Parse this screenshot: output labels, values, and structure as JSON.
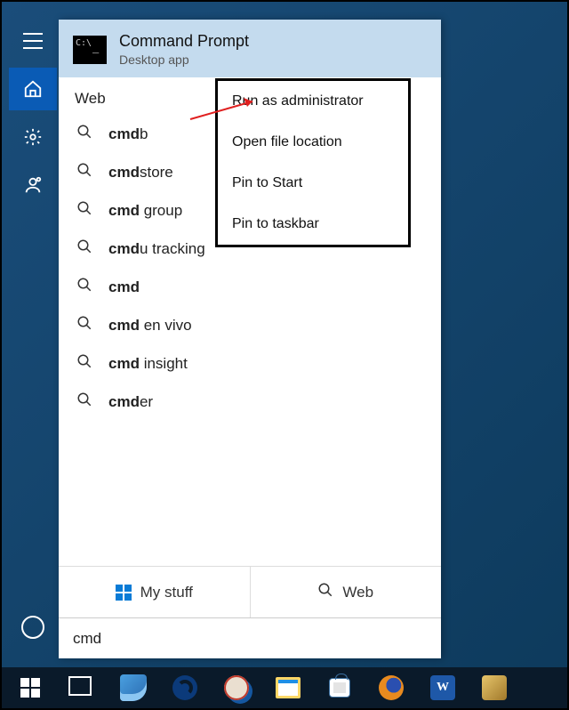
{
  "rail": {
    "items": [
      "menu",
      "home",
      "settings",
      "feedback",
      "cortana"
    ]
  },
  "bestMatch": {
    "title": "Command Prompt",
    "subtitle": "Desktop app"
  },
  "sectionHeader": "Web",
  "results": [
    {
      "pre": "cmd",
      "post": "b"
    },
    {
      "pre": "cmd",
      "post": "store"
    },
    {
      "pre": "cmd",
      "post": " group"
    },
    {
      "pre": "cmd",
      "post": "u tracking"
    },
    {
      "pre": "cmd",
      "post": ""
    },
    {
      "pre": "cmd",
      "post": " en vivo"
    },
    {
      "pre": "cmd",
      "post": " insight"
    },
    {
      "pre": "cmd",
      "post": "er"
    }
  ],
  "tabs": {
    "mystuff": "My stuff",
    "web": "Web"
  },
  "searchValue": "cmd",
  "context": {
    "items": [
      "Run as administrator",
      "Open file location",
      "Pin to Start",
      "Pin to taskbar"
    ]
  },
  "taskbarApps": [
    "paint",
    "edge",
    "snip",
    "explorer",
    "store",
    "firefox",
    "word",
    "av"
  ]
}
